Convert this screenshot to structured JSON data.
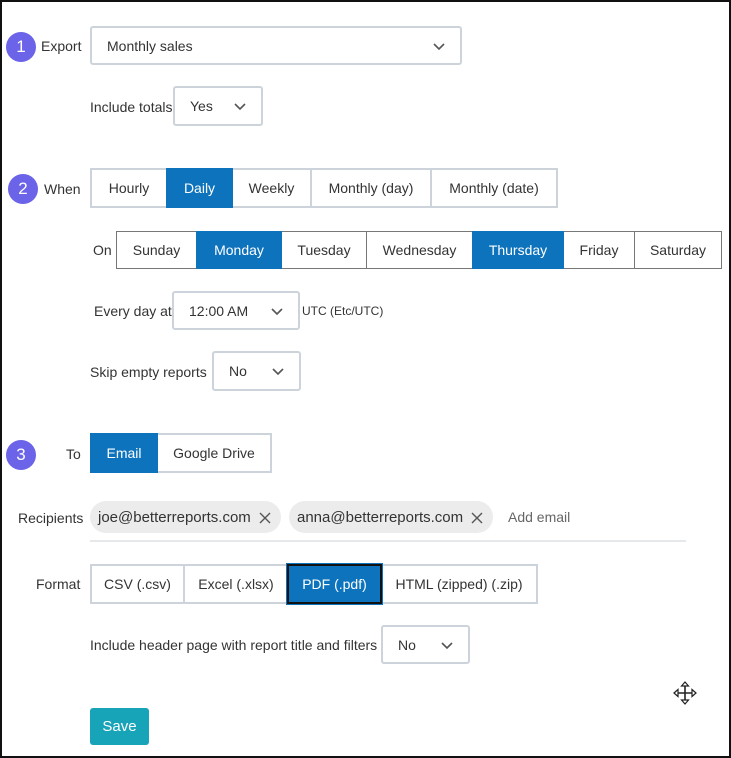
{
  "export": {
    "step": "1",
    "label": "Export",
    "value": "Monthly sales",
    "include_totals_label": "Include totals",
    "include_totals_value": "Yes"
  },
  "when": {
    "step": "2",
    "label": "When",
    "frequency": [
      "Hourly",
      "Daily",
      "Weekly",
      "Monthly (day)",
      "Monthly (date)"
    ],
    "frequency_selected": "Daily",
    "on_label": "On",
    "days": [
      "Sunday",
      "Monday",
      "Tuesday",
      "Wednesday",
      "Thursday",
      "Friday",
      "Saturday"
    ],
    "days_selected": [
      "Monday",
      "Thursday"
    ],
    "every_day_label": "Every day at",
    "time_value": "12:00 AM",
    "timezone": "UTC (Etc/UTC)",
    "skip_label": "Skip empty reports",
    "skip_value": "No"
  },
  "to": {
    "step": "3",
    "label": "To",
    "destinations": [
      "Email",
      "Google Drive"
    ],
    "destination_selected": "Email",
    "recipients_label": "Recipients",
    "recipients": [
      "joe@betterreports.com",
      "anna@betterreports.com"
    ],
    "add_email_placeholder": "Add email",
    "format_label": "Format",
    "formats": [
      "CSV (.csv)",
      "Excel (.xlsx)",
      "PDF (.pdf)",
      "HTML (zipped) (.zip)"
    ],
    "format_selected": "PDF (.pdf)",
    "header_page_label": "Include header page with report title and filters",
    "header_page_value": "No"
  },
  "save_label": "Save",
  "colors": {
    "step_badge": "#6b63e8",
    "selected": "#0d73bd",
    "save": "#17a3b8"
  },
  "icons": [
    "chevron-down-icon",
    "close-icon",
    "move-icon"
  ]
}
